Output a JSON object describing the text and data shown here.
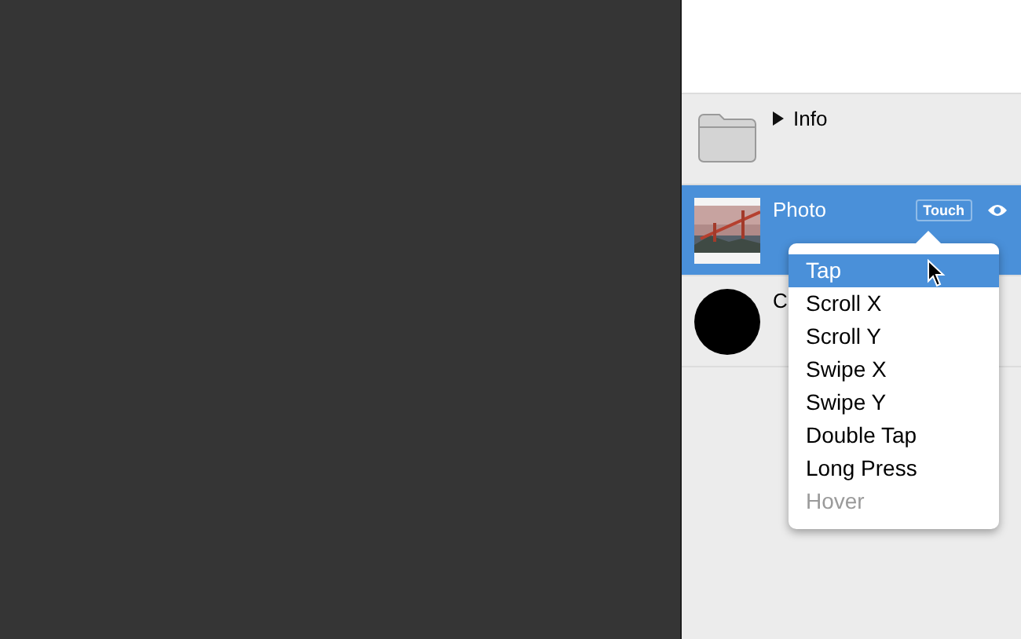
{
  "layers": [
    {
      "kind": "folder",
      "name": "Info",
      "expanded": false,
      "selected": false
    },
    {
      "name": "Photo",
      "selected": true,
      "badge": "Touch"
    },
    {
      "kind": "circle",
      "name": "C",
      "selected": false
    }
  ],
  "menu": {
    "items": [
      {
        "label": "Tap",
        "selected": true,
        "disabled": false
      },
      {
        "label": "Scroll X",
        "selected": false,
        "disabled": false
      },
      {
        "label": "Scroll Y",
        "selected": false,
        "disabled": false
      },
      {
        "label": "Swipe X",
        "selected": false,
        "disabled": false
      },
      {
        "label": "Swipe Y",
        "selected": false,
        "disabled": false
      },
      {
        "label": "Double Tap",
        "selected": false,
        "disabled": false
      },
      {
        "label": "Long Press",
        "selected": false,
        "disabled": false
      },
      {
        "label": "Hover",
        "selected": false,
        "disabled": true
      }
    ]
  }
}
